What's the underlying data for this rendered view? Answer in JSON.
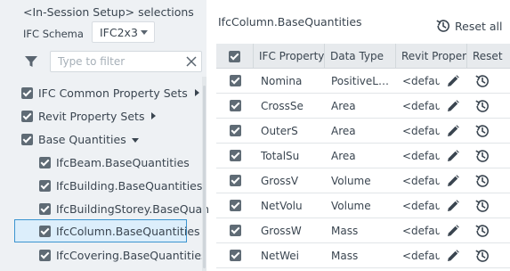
{
  "left": {
    "title": "<In-Session Setup> selections",
    "schema_label": "IFC Schema",
    "schema_value": "IFC2x3",
    "filter_placeholder": "Type to filter",
    "tree": [
      {
        "label": "IFC Common Property Sets",
        "checked": true,
        "expander": "collapsed"
      },
      {
        "label": "Revit Property Sets",
        "checked": true,
        "expander": "collapsed"
      },
      {
        "label": "Base Quantities",
        "checked": true,
        "expander": "expanded"
      },
      {
        "label": "IfcBeam.BaseQuantities",
        "checked": true
      },
      {
        "label": "IfcBuilding.BaseQuantities",
        "checked": true
      },
      {
        "label": "IfcBuildingStorey.BaseQuan",
        "checked": true
      },
      {
        "label": "IfcColumn.BaseQuantities",
        "checked": true,
        "selected": true
      },
      {
        "label": "IfcCovering.BaseQuantities",
        "checked": true
      }
    ]
  },
  "right": {
    "title": "IfcColumn.BaseQuantities",
    "reset_all_label": "Reset all",
    "columns": {
      "property": "IFC Property",
      "data_type": "Data Type",
      "revit_property": "Revit Proper",
      "reset": "Reset"
    },
    "rows": [
      {
        "property": "Nomina",
        "data_type": "PositiveL…",
        "revit_property": "<defau"
      },
      {
        "property": "CrossSe",
        "data_type": "Area",
        "revit_property": "<defau"
      },
      {
        "property": "OuterS",
        "data_type": "Area",
        "revit_property": "<defau"
      },
      {
        "property": "TotalSu",
        "data_type": "Area",
        "revit_property": "<defau"
      },
      {
        "property": "GrossV",
        "data_type": "Volume",
        "revit_property": "<defau"
      },
      {
        "property": "NetVolu",
        "data_type": "Volume",
        "revit_property": "<defau"
      },
      {
        "property": "GrossW",
        "data_type": "Mass",
        "revit_property": "<defau"
      },
      {
        "property": "NetWei",
        "data_type": "Mass",
        "revit_property": "<defau"
      }
    ]
  },
  "icons": {
    "filter": "filter-icon",
    "clear": "close-icon",
    "reset_all": "history-icon",
    "edit": "pencil-icon",
    "reset": "history-icon"
  },
  "colors": {
    "panel_bg": "#eef1f4",
    "selection_border": "#3b94d0",
    "selection_bg": "#dceefb",
    "checkbox": "#5f6b75",
    "header_bg": "#e7eaed"
  }
}
